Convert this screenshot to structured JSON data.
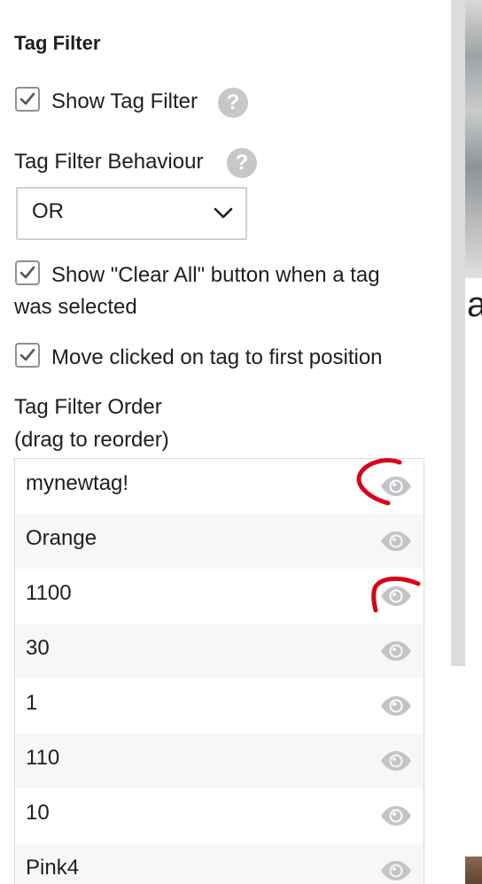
{
  "section_title": "Tag Filter",
  "show_tag_filter": {
    "label": "Show Tag Filter",
    "checked": true
  },
  "behaviour": {
    "label": "Tag Filter Behaviour",
    "selected": "OR"
  },
  "show_clear_all": {
    "label_line1": "Show \"Clear All\" button when a tag",
    "label_line2": "was selected",
    "checked": true
  },
  "move_clicked": {
    "label": "Move clicked on tag to first position",
    "checked": true
  },
  "order": {
    "label_line1": "Tag Filter Order",
    "label_line2": "(drag to reorder)",
    "tags": [
      "mynewtag!",
      "Orange",
      "1100",
      "30",
      "1",
      "110",
      "10",
      "Pink4"
    ]
  },
  "side_text": "a",
  "colors": {
    "annotation": "#d9001b",
    "eye": "#c3c4c7",
    "help": "#c7c7c7"
  },
  "icons": {
    "checkbox": "checkmark-icon",
    "help": "question-mark-icon",
    "dropdown": "chevron-down-icon",
    "visibility": "eye-icon"
  }
}
